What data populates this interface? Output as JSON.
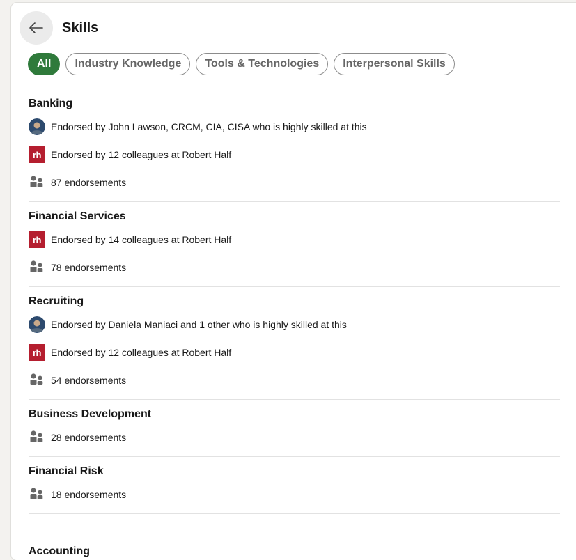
{
  "header": {
    "title": "Skills"
  },
  "filters": [
    {
      "label": "All",
      "active": true
    },
    {
      "label": "Industry Knowledge",
      "active": false
    },
    {
      "label": "Tools & Technologies",
      "active": false
    },
    {
      "label": "Interpersonal Skills",
      "active": false
    }
  ],
  "skills": [
    {
      "name": "Banking",
      "details": [
        {
          "icon": "person-avatar",
          "text": "Endorsed by John Lawson, CRCM, CIA, CISA who is highly skilled at this"
        },
        {
          "icon": "robert-half-logo",
          "text": "Endorsed by 12 colleagues at Robert Half"
        },
        {
          "icon": "people-icon",
          "text": "87 endorsements"
        }
      ]
    },
    {
      "name": "Financial Services",
      "details": [
        {
          "icon": "robert-half-logo",
          "text": "Endorsed by 14 colleagues at Robert Half"
        },
        {
          "icon": "people-icon",
          "text": "78 endorsements"
        }
      ]
    },
    {
      "name": "Recruiting",
      "details": [
        {
          "icon": "person-avatar",
          "text": "Endorsed by Daniela Maniaci and 1 other who is highly skilled at this"
        },
        {
          "icon": "robert-half-logo",
          "text": "Endorsed by 12 colleagues at Robert Half"
        },
        {
          "icon": "people-icon",
          "text": "54 endorsements"
        }
      ]
    },
    {
      "name": "Business Development",
      "details": [
        {
          "icon": "people-icon",
          "text": "28 endorsements"
        }
      ]
    },
    {
      "name": "Financial Risk",
      "details": [
        {
          "icon": "people-icon",
          "text": "18 endorsements"
        }
      ]
    }
  ],
  "partial_next_skill": "Accounting",
  "logo_text": "rh",
  "colors": {
    "active_pill": "#2f7a3b",
    "robert_half": "#b51e2f",
    "divider": "#e2e2e2"
  }
}
